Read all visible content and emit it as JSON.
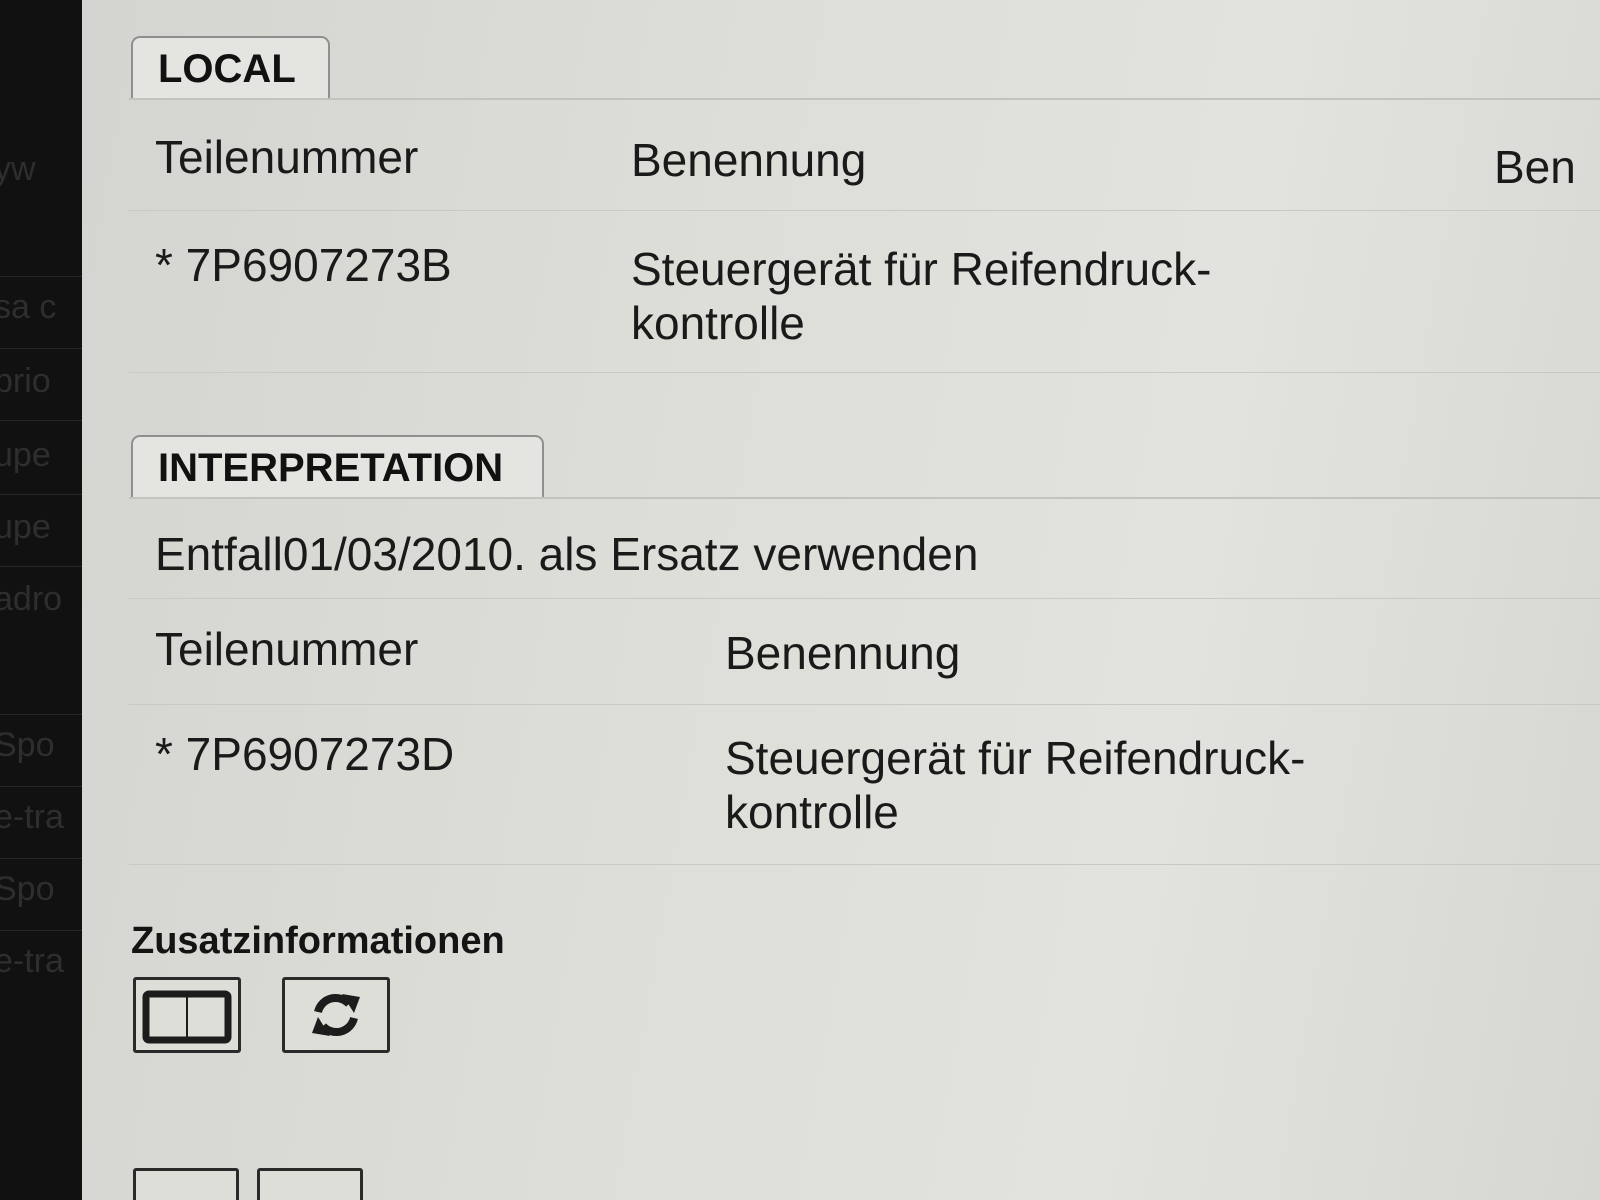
{
  "background_fragments": [
    "yw",
    "sa c",
    "prio",
    "upe",
    "upe",
    "adro",
    "Spo",
    "e-tra",
    "Spo",
    "e-tra"
  ],
  "local_section": {
    "tab_label": "LOCAL",
    "columns": [
      "Teilenummer",
      "Benennung",
      "Ben"
    ],
    "rows": [
      {
        "part_number": "* 7P6907273B",
        "description": "Steuergerät für Reifendruck-kontrolle"
      }
    ]
  },
  "interpretation_section": {
    "tab_label": "INTERPRETATION",
    "note": "Entfall01/03/2010. als Ersatz verwenden",
    "columns": [
      "Teilenummer",
      "Benennung"
    ],
    "rows": [
      {
        "part_number": "* 7P6907273D",
        "description": "Steuergerät für Reifendruck-kontrolle"
      }
    ]
  },
  "additional_info": {
    "title": "Zusatzinformationen",
    "buttons": [
      {
        "icon": "book-icon"
      },
      {
        "icon": "refresh-icon"
      }
    ]
  },
  "colors": {
    "panel_bg": "#deded9",
    "text": "#1a1a1a",
    "tab_border": "#8f8f8f",
    "outside_dark": "#111111"
  }
}
